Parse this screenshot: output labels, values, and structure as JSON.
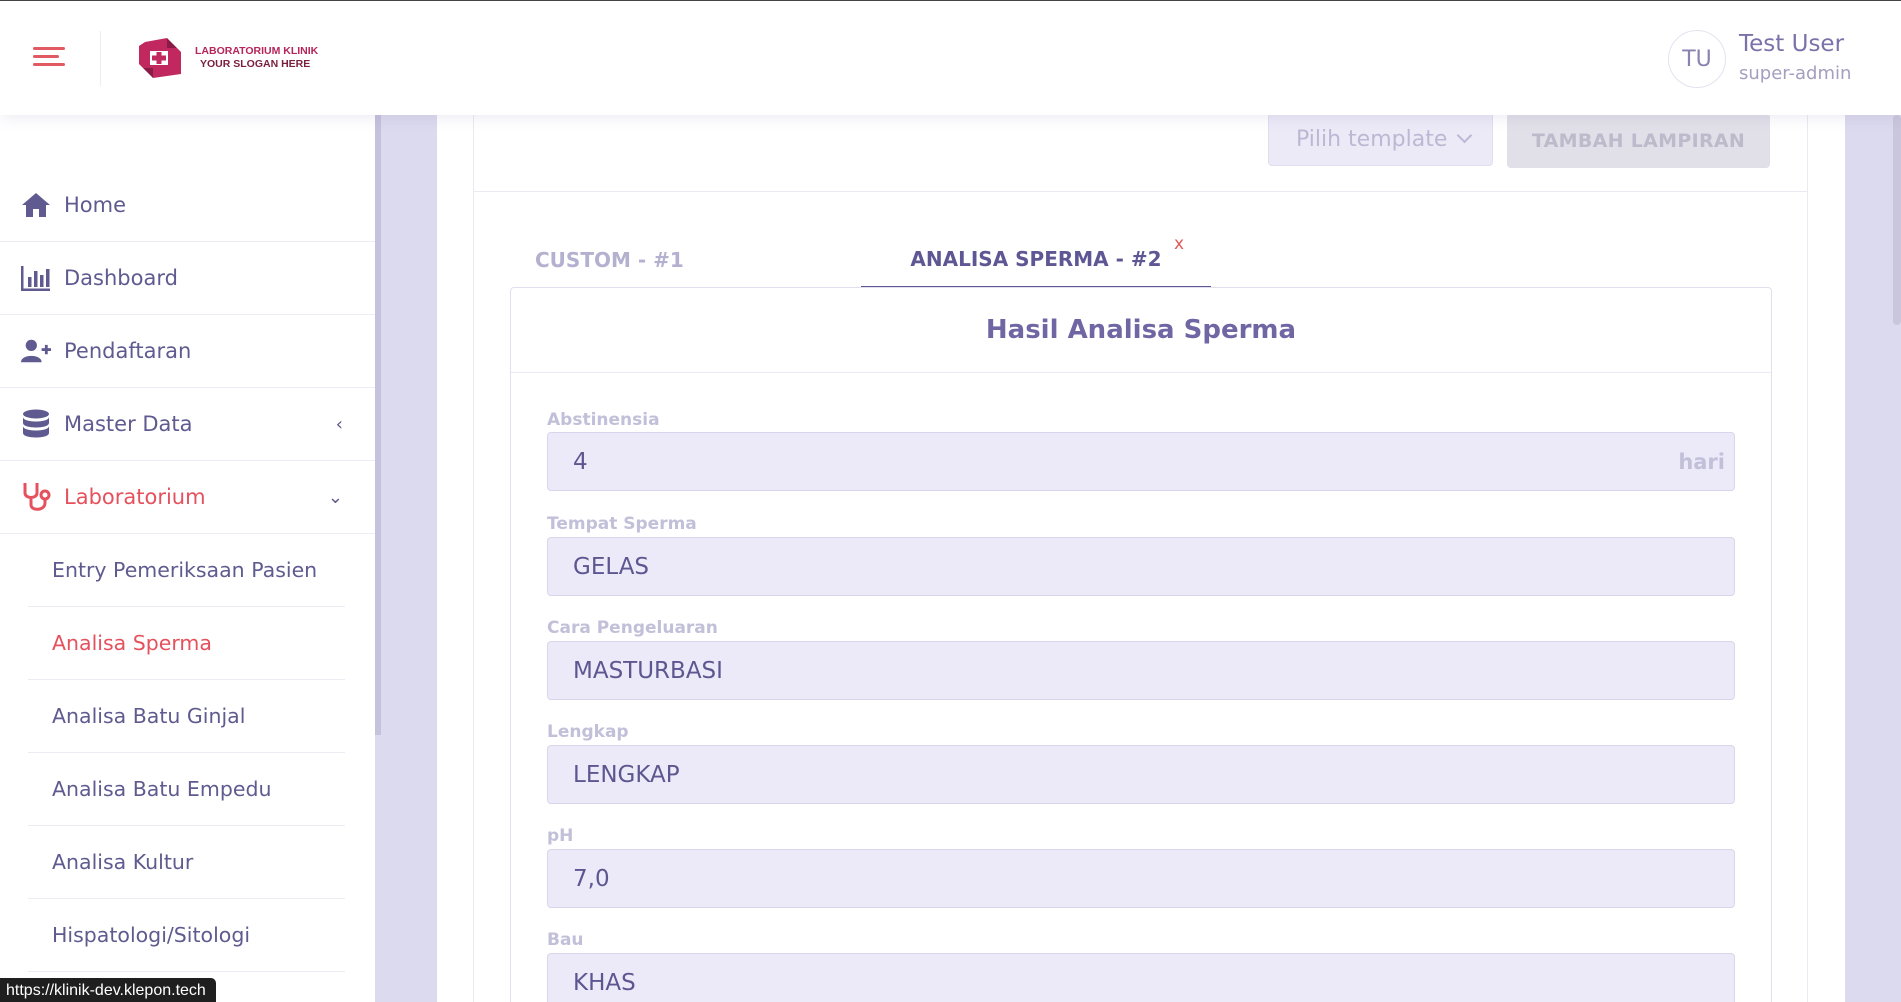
{
  "header": {
    "logo_line1": "LABORATORIUM KLINIK",
    "logo_line2": "YOUR SLOGAN HERE",
    "user_initials": "TU",
    "user_name": "Test User",
    "user_role": "super-admin"
  },
  "sidebar": {
    "items": [
      {
        "label": "Home",
        "icon": "home-icon"
      },
      {
        "label": "Dashboard",
        "icon": "chart-bar-icon"
      },
      {
        "label": "Pendaftaran",
        "icon": "user-plus-icon"
      },
      {
        "label": "Master Data",
        "icon": "database-icon",
        "chevron": "‹"
      },
      {
        "label": "Laboratorium",
        "icon": "stethoscope-icon",
        "chevron": "⌄"
      }
    ],
    "sub_items": [
      {
        "label": "Entry Pemeriksaan Pasien"
      },
      {
        "label": "Analisa Sperma"
      },
      {
        "label": "Analisa Batu Ginjal"
      },
      {
        "label": "Analisa Batu Empedu"
      },
      {
        "label": "Analisa Kultur"
      },
      {
        "label": "Hispatologi/Sitologi"
      }
    ]
  },
  "status_bar": {
    "url": "https://klinik-dev.klepon.tech"
  },
  "toolbar": {
    "template_placeholder": "Pilih template",
    "add_attachment_label": "TAMBAH LAMPIRAN"
  },
  "tabs": [
    {
      "label": "CUSTOM - #1"
    },
    {
      "label": "ANALISA SPERMA - #2",
      "close": "x"
    }
  ],
  "form": {
    "title": "Hasil Analisa Sperma",
    "fields": [
      {
        "label": "Abstinensia",
        "value": "4",
        "suffix": "hari"
      },
      {
        "label": "Tempat Sperma",
        "value": "GELAS"
      },
      {
        "label": "Cara Pengeluaran",
        "value": "MASTURBASI"
      },
      {
        "label": "Lengkap",
        "value": "LENGKAP"
      },
      {
        "label": "pH",
        "value": "7,0"
      },
      {
        "label": "Bau",
        "value": "KHAS"
      }
    ]
  },
  "colors": {
    "accent_red": "#e5515c",
    "primary_purple": "#5f5a8f",
    "input_bg": "#eceaf8",
    "page_bg": "#dcdaee"
  }
}
